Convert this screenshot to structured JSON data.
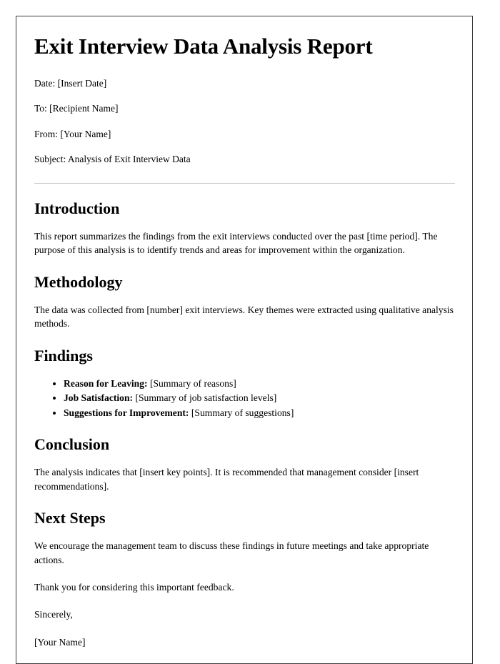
{
  "document": {
    "title": "Exit Interview Data Analysis Report",
    "metadata": [
      {
        "text": "Date: [Insert Date]"
      },
      {
        "text": "To: [Recipient Name]"
      },
      {
        "text": "From: [Your Name]"
      },
      {
        "text": "Subject: Analysis of Exit Interview Data"
      }
    ],
    "sections": {
      "introduction": {
        "heading": "Introduction",
        "paragraph": "This report summarizes the findings from the exit interviews conducted over the past [time period]. The purpose of this analysis is to identify trends and areas for improvement within the organization."
      },
      "methodology": {
        "heading": "Methodology",
        "paragraph": "The data was collected from [number] exit interviews. Key themes were extracted using qualitative analysis methods."
      },
      "findings": {
        "heading": "Findings",
        "items": [
          {
            "label": "Reason for Leaving:",
            "value": "[Summary of reasons]"
          },
          {
            "label": "Job Satisfaction:",
            "value": "[Summary of job satisfaction levels]"
          },
          {
            "label": "Suggestions for Improvement:",
            "value": "[Summary of suggestions]"
          }
        ]
      },
      "conclusion": {
        "heading": "Conclusion",
        "paragraph": "The analysis indicates that [insert key points]. It is recommended that management consider [insert recommendations]."
      },
      "next_steps": {
        "heading": "Next Steps",
        "paragraph": "We encourage the management team to discuss these findings in future meetings and take appropriate actions.",
        "thanks": "Thank you for considering this important feedback.",
        "signoff": "Sincerely,",
        "signature": "[Your Name]"
      }
    }
  }
}
